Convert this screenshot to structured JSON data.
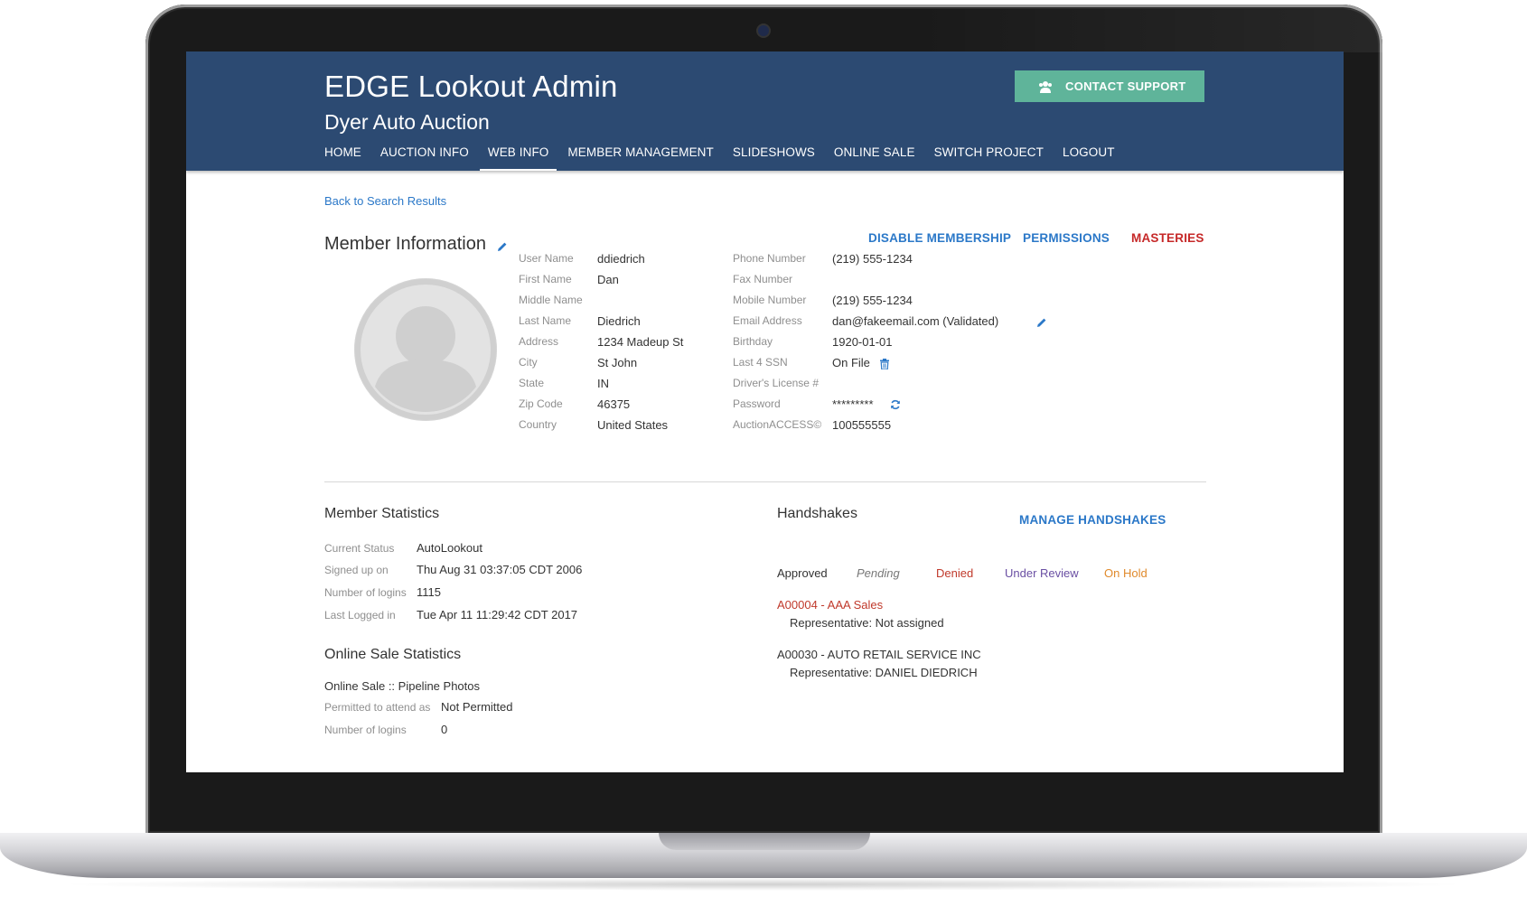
{
  "header": {
    "title": "EDGE Lookout Admin",
    "subtitle": "Dyer Auto Auction",
    "support_label": "CONTACT SUPPORT",
    "support_icon": "users-icon",
    "nav": [
      "HOME",
      "AUCTION INFO",
      "WEB INFO",
      "MEMBER MANAGEMENT",
      "SLIDESHOWS",
      "ONLINE SALE",
      "SWITCH PROJECT",
      "LOGOUT"
    ],
    "active_nav": "WEB INFO"
  },
  "back_link": "Back to Search Results",
  "member_info": {
    "title": "Member Information",
    "actions": {
      "disable": "DISABLE MEMBERSHIP",
      "permissions": "PERMISSIONS",
      "masteries": "MASTERIES"
    },
    "left_fields": [
      {
        "label": "User Name",
        "value": "ddiedrich"
      },
      {
        "label": "First Name",
        "value": "Dan"
      },
      {
        "label": "Middle Name",
        "value": ""
      },
      {
        "label": "Last Name",
        "value": "Diedrich"
      },
      {
        "label": "Address",
        "value": "1234 Madeup St"
      },
      {
        "label": "City",
        "value": "St John"
      },
      {
        "label": "State",
        "value": "IN"
      },
      {
        "label": "Zip Code",
        "value": "46375"
      },
      {
        "label": "Country",
        "value": "United States"
      }
    ],
    "right_fields": [
      {
        "label": "Phone Number",
        "value": "(219) 555-1234"
      },
      {
        "label": "Fax Number",
        "value": ""
      },
      {
        "label": "Mobile Number",
        "value": "(219) 555-1234"
      },
      {
        "label": "Email Address",
        "value": "dan@fakeemail.com (Validated)"
      },
      {
        "label": "Birthday",
        "value": "1920-01-01"
      },
      {
        "label": "Last 4 SSN",
        "value": "On File"
      },
      {
        "label": "Driver's License #",
        "value": ""
      },
      {
        "label": "Password",
        "value": "*********"
      },
      {
        "label": "AuctionACCESS©",
        "value": "100555555"
      }
    ]
  },
  "member_statistics": {
    "title": "Member Statistics",
    "rows": [
      {
        "label": "Current Status",
        "value": "AutoLookout"
      },
      {
        "label": "Signed up on",
        "value": "Thu Aug 31 03:37:05 CDT 2006"
      },
      {
        "label": "Number of logins",
        "value": "1115"
      },
      {
        "label": "Last Logged in",
        "value": "Tue Apr 11 11:29:42 CDT 2017"
      }
    ]
  },
  "online_sale_statistics": {
    "title": "Online Sale Statistics",
    "sale_name": "Online Sale :: Pipeline Photos",
    "rows": [
      {
        "label": "Permitted to attend as",
        "value": "Not Permitted"
      },
      {
        "label": "Number of logins",
        "value": "0"
      }
    ]
  },
  "handshakes": {
    "title": "Handshakes",
    "manage_label": "MANAGE HANDSHAKES",
    "legend": [
      {
        "label": "Approved",
        "color": "#333333"
      },
      {
        "label": "Pending",
        "color": "#777777"
      },
      {
        "label": "Denied",
        "color": "#c0392b"
      },
      {
        "label": "Under Review",
        "color": "#6a4fa3"
      },
      {
        "label": "On Hold",
        "color": "#e08a2c"
      }
    ],
    "items": [
      {
        "company": "A00004 - AAA Sales",
        "representative": "Representative: Not assigned",
        "color": "#c0392b"
      },
      {
        "company": "A00030 - AUTO RETAIL SERVICE INC",
        "representative": "Representative: DANIEL DIEDRICH",
        "color": "#333333"
      }
    ]
  },
  "colors": {
    "header_bg": "#2c4a72",
    "support_bg": "#5fb49a",
    "link": "#2b78c8",
    "masteries": "#c62828"
  }
}
